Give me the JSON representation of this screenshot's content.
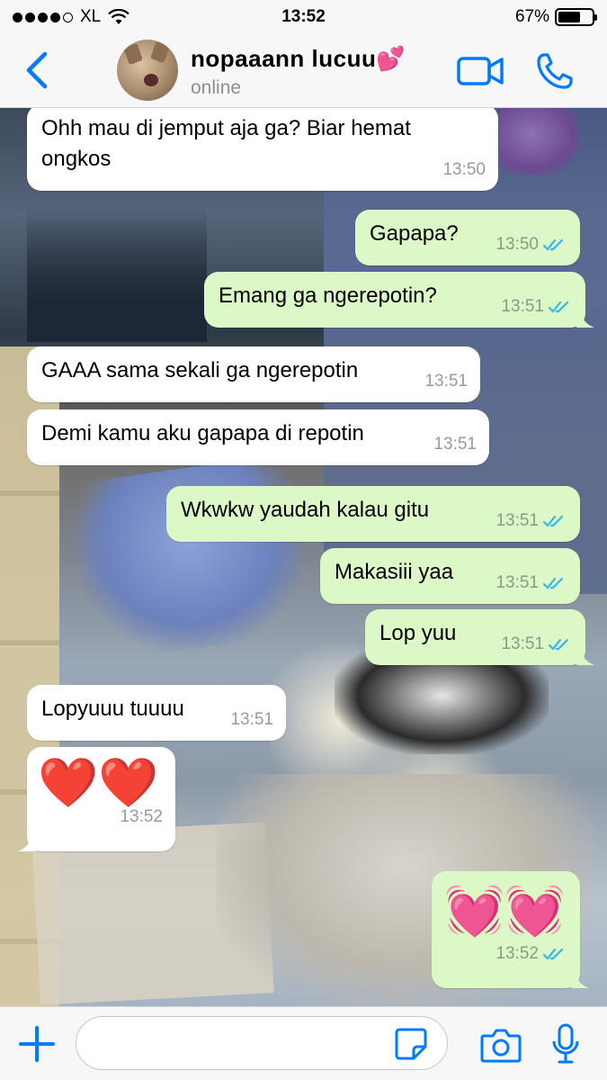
{
  "status_bar": {
    "carrier": "XL",
    "time": "13:52",
    "battery_percent_label": "67%",
    "battery_level": 0.67
  },
  "header": {
    "contact_name": "nopaaann lucuu💕",
    "contact_status": "online",
    "accent_color": "#007aff"
  },
  "messages": [
    {
      "side": "in",
      "text": "Ohh mau di jemput aja ga? Biar hemat ongkos",
      "time": "13:50"
    },
    {
      "side": "out",
      "text": "Gapapa?",
      "time": "13:50",
      "status": "read"
    },
    {
      "side": "out",
      "text": "Emang ga ngerepotin?",
      "time": "13:51",
      "status": "read"
    },
    {
      "side": "in",
      "text": "GAAA sama sekali ga ngerepotin",
      "time": "13:51"
    },
    {
      "side": "in",
      "text": "Demi kamu aku gapapa di repotin",
      "time": "13:51"
    },
    {
      "side": "out",
      "text": "Wkwkw yaudah kalau gitu",
      "time": "13:51",
      "status": "read"
    },
    {
      "side": "out",
      "text": "Makasiii yaa",
      "time": "13:51",
      "status": "read"
    },
    {
      "side": "out",
      "text": "Lop yuu",
      "time": "13:51",
      "status": "read"
    },
    {
      "side": "in",
      "text": "Lopyuuu tuuuu",
      "time": "13:51"
    },
    {
      "side": "in",
      "text": "❤️❤️",
      "time": "13:52"
    },
    {
      "side": "out",
      "text": "💓💓",
      "time": "13:52",
      "status": "read"
    }
  ],
  "input_bar": {
    "placeholder": ""
  },
  "colors": {
    "outgoing_bubble": "#dcf8c6",
    "incoming_bubble": "#ffffff",
    "read_ticks": "#34b7f1"
  }
}
